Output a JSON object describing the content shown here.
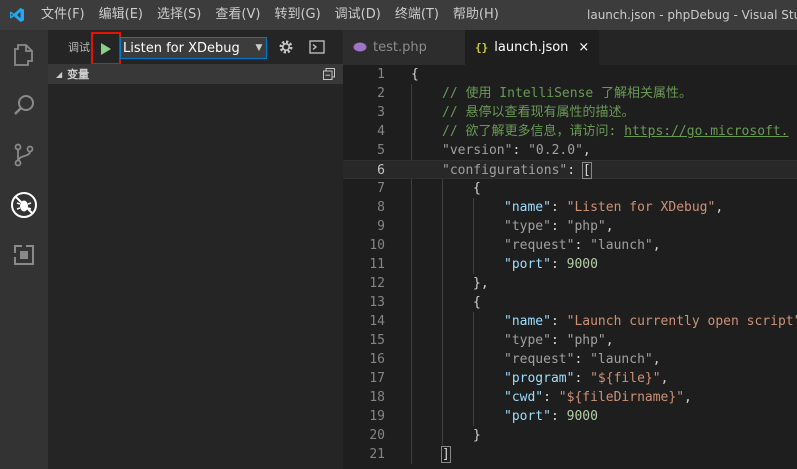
{
  "titlebar": {
    "logo_icon": "vscode-logo-icon",
    "menu": [
      {
        "label": "文件(F)"
      },
      {
        "label": "编辑(E)"
      },
      {
        "label": "选择(S)"
      },
      {
        "label": "查看(V)"
      },
      {
        "label": "转到(G)"
      },
      {
        "label": "调试(D)"
      },
      {
        "label": "终端(T)"
      },
      {
        "label": "帮助(H)"
      }
    ],
    "window_title": "launch.json - phpDebug - Visual Studio"
  },
  "activitybar": {
    "items": [
      {
        "icon": "files-icon"
      },
      {
        "icon": "search-icon"
      },
      {
        "icon": "source-control-icon"
      },
      {
        "icon": "debug-icon",
        "active": true
      },
      {
        "icon": "extensions-icon"
      }
    ]
  },
  "debug": {
    "title": "调试",
    "start_icon": "play-icon",
    "configuration": "Listen for XDebug",
    "caret": "▼",
    "gear_icon": "gear-icon",
    "console_icon": "debug-console-icon",
    "variables_section": "变量",
    "section_arrow": "◢"
  },
  "tabs": [
    {
      "label": "test.php",
      "icon": "php-file-icon",
      "active": false
    },
    {
      "label": "launch.json",
      "icon": "json-file-icon",
      "icon_glyph": "{}",
      "active": true,
      "close": "×"
    }
  ],
  "editor": {
    "current_line": 6,
    "lines": [
      {
        "n": "1",
        "text": "{"
      },
      {
        "n": "2",
        "text": "// 使用 IntelliSense 了解相关属性。"
      },
      {
        "n": "3",
        "text": "// 悬停以查看现有属性的描述。"
      },
      {
        "n": "4",
        "text": "// 欲了解更多信息，请访问: ",
        "link": "https://go.microsoft."
      },
      {
        "n": "5",
        "key": "\"version\"",
        "sep": ": ",
        "value": "\"0.2.0\"",
        "end": ","
      },
      {
        "n": "6",
        "key": "\"configurations\"",
        "sep": ": ",
        "bracket": "["
      },
      {
        "n": "7",
        "text": "{"
      },
      {
        "n": "8",
        "key": "\"name\"",
        "sep": ": ",
        "value": "\"Listen for XDebug\"",
        "end": ","
      },
      {
        "n": "9",
        "key": "\"type\"",
        "sep": ": ",
        "value": "\"php\"",
        "end": ","
      },
      {
        "n": "10",
        "key": "\"request\"",
        "sep": ": ",
        "value": "\"launch\"",
        "end": ","
      },
      {
        "n": "11",
        "key": "\"port\"",
        "sep": ": ",
        "number": "9000"
      },
      {
        "n": "12",
        "text": "},"
      },
      {
        "n": "13",
        "text": "{"
      },
      {
        "n": "14",
        "key": "\"name\"",
        "sep": ": ",
        "value": "\"Launch currently open script\""
      },
      {
        "n": "15",
        "key": "\"type\"",
        "sep": ": ",
        "value": "\"php\"",
        "end": ","
      },
      {
        "n": "16",
        "key": "\"request\"",
        "sep": ": ",
        "value": "\"launch\"",
        "end": ","
      },
      {
        "n": "17",
        "key": "\"program\"",
        "sep": ": ",
        "value": "\"${file}\"",
        "end": ","
      },
      {
        "n": "18",
        "key": "\"cwd\"",
        "sep": ": ",
        "value": "\"${fileDirname}\"",
        "end": ","
      },
      {
        "n": "19",
        "key": "\"port\"",
        "sep": ": ",
        "number": "9000"
      },
      {
        "n": "20",
        "text": "}"
      },
      {
        "n": "21",
        "bracket": "]"
      }
    ]
  }
}
